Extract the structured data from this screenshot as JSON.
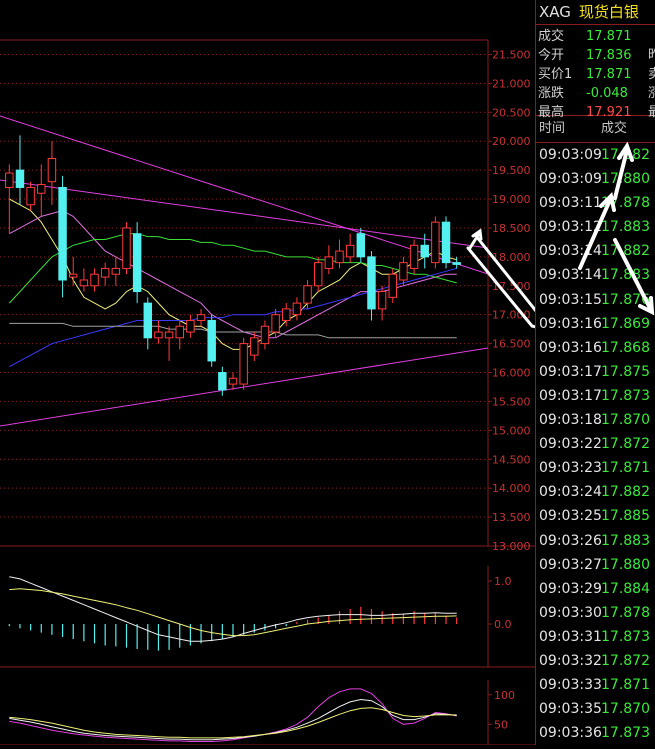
{
  "header": {
    "symbol": "XAG",
    "name": "现货白银"
  },
  "quote": [
    {
      "label": "成交",
      "value": "17.871",
      "trail": "",
      "color": "green"
    },
    {
      "label": "今开",
      "value": "17.836",
      "trail": "昨",
      "color": "green"
    },
    {
      "label": "买价1",
      "value": "17.871",
      "trail": "卖",
      "color": "green"
    },
    {
      "label": "涨跌",
      "value": "-0.048",
      "trail": "涨",
      "color": "green"
    },
    {
      "label": "最高",
      "value": "17.921",
      "trail": "最",
      "color": "red"
    }
  ],
  "ticks_header": {
    "time": "时间",
    "price": "成交"
  },
  "ticks": [
    {
      "time": "09:03:09",
      "price": "17.882"
    },
    {
      "time": "09:03:09",
      "price": "17.880"
    },
    {
      "time": "09:03:11",
      "price": "17.878"
    },
    {
      "time": "09:03:12",
      "price": "17.883"
    },
    {
      "time": "09:03:14",
      "price": "17.882"
    },
    {
      "time": "09:03:14",
      "price": "17.883"
    },
    {
      "time": "09:03:15",
      "price": "17.876"
    },
    {
      "time": "09:03:16",
      "price": "17.869"
    },
    {
      "time": "09:03:16",
      "price": "17.868"
    },
    {
      "time": "09:03:17",
      "price": "17.875"
    },
    {
      "time": "09:03:17",
      "price": "17.873"
    },
    {
      "time": "09:03:18",
      "price": "17.870"
    },
    {
      "time": "09:03:22",
      "price": "17.872"
    },
    {
      "time": "09:03:23",
      "price": "17.871"
    },
    {
      "time": "09:03:24",
      "price": "17.882"
    },
    {
      "time": "09:03:25",
      "price": "17.885"
    },
    {
      "time": "09:03:26",
      "price": "17.883"
    },
    {
      "time": "09:03:27",
      "price": "17.880"
    },
    {
      "time": "09:03:29",
      "price": "17.884"
    },
    {
      "time": "09:03:30",
      "price": "17.878"
    },
    {
      "time": "09:03:31",
      "price": "17.873"
    },
    {
      "time": "09:03:32",
      "price": "17.872"
    },
    {
      "time": "09:03:33",
      "price": "17.871"
    },
    {
      "time": "09:03:35",
      "price": "17.870"
    },
    {
      "time": "09:03:36",
      "price": "17.873"
    }
  ],
  "colors": {
    "up": "#ff3b3b",
    "down": "#54f0f0",
    "grid": "#8a1c1c",
    "axis_text": "#c83232"
  },
  "chart_data": [
    {
      "type": "candlestick",
      "title": "",
      "ylim": [
        13.0,
        21.75
      ],
      "y_ticks": [
        "21.500",
        "21.000",
        "20.500",
        "20.000",
        "19.500",
        "19.000",
        "18.500",
        "18.000",
        "17.500",
        "17.000",
        "16.500",
        "16.000",
        "15.500",
        "15.000",
        "14.500",
        "14.000",
        "13.500",
        "13.000"
      ],
      "candles": [
        {
          "o": 19.2,
          "h": 19.6,
          "l": 18.4,
          "c": 19.45
        },
        {
          "o": 19.5,
          "h": 20.1,
          "l": 18.9,
          "c": 19.2
        },
        {
          "o": 18.9,
          "h": 19.3,
          "l": 18.8,
          "c": 19.2
        },
        {
          "o": 19.1,
          "h": 19.6,
          "l": 18.7,
          "c": 19.25
        },
        {
          "o": 19.3,
          "h": 20.0,
          "l": 18.9,
          "c": 19.7
        },
        {
          "o": 19.2,
          "h": 19.4,
          "l": 17.3,
          "c": 17.6
        },
        {
          "o": 17.65,
          "h": 18.0,
          "l": 17.5,
          "c": 17.7
        },
        {
          "o": 17.5,
          "h": 17.8,
          "l": 17.4,
          "c": 17.6
        },
        {
          "o": 17.5,
          "h": 17.8,
          "l": 17.4,
          "c": 17.7
        },
        {
          "o": 17.65,
          "h": 17.9,
          "l": 17.5,
          "c": 17.8
        },
        {
          "o": 17.7,
          "h": 18.0,
          "l": 17.5,
          "c": 17.8
        },
        {
          "o": 17.8,
          "h": 18.6,
          "l": 17.7,
          "c": 18.5
        },
        {
          "o": 18.4,
          "h": 18.6,
          "l": 17.2,
          "c": 17.4
        },
        {
          "o": 17.2,
          "h": 17.3,
          "l": 16.4,
          "c": 16.6
        },
        {
          "o": 16.6,
          "h": 16.9,
          "l": 16.5,
          "c": 16.7
        },
        {
          "o": 16.6,
          "h": 16.8,
          "l": 16.2,
          "c": 16.7
        },
        {
          "o": 16.6,
          "h": 16.9,
          "l": 16.4,
          "c": 16.8
        },
        {
          "o": 16.7,
          "h": 17.0,
          "l": 16.6,
          "c": 16.9
        },
        {
          "o": 16.9,
          "h": 17.1,
          "l": 16.8,
          "c": 17.0
        },
        {
          "o": 16.9,
          "h": 17.0,
          "l": 16.1,
          "c": 16.2
        },
        {
          "o": 16.0,
          "h": 16.1,
          "l": 15.6,
          "c": 15.7
        },
        {
          "o": 15.8,
          "h": 16.0,
          "l": 15.7,
          "c": 15.9
        },
        {
          "o": 15.8,
          "h": 16.6,
          "l": 15.7,
          "c": 16.5
        },
        {
          "o": 16.3,
          "h": 16.7,
          "l": 16.2,
          "c": 16.6
        },
        {
          "o": 16.5,
          "h": 16.9,
          "l": 16.4,
          "c": 16.8
        },
        {
          "o": 16.7,
          "h": 17.1,
          "l": 16.6,
          "c": 17.0
        },
        {
          "o": 16.9,
          "h": 17.2,
          "l": 16.8,
          "c": 17.1
        },
        {
          "o": 17.0,
          "h": 17.3,
          "l": 16.9,
          "c": 17.2
        },
        {
          "o": 17.2,
          "h": 17.6,
          "l": 17.1,
          "c": 17.5
        },
        {
          "o": 17.5,
          "h": 18.0,
          "l": 17.4,
          "c": 17.9
        },
        {
          "o": 17.8,
          "h": 18.2,
          "l": 17.7,
          "c": 18.0
        },
        {
          "o": 17.9,
          "h": 18.3,
          "l": 17.8,
          "c": 18.1
        },
        {
          "o": 18.0,
          "h": 18.4,
          "l": 17.9,
          "c": 18.2
        },
        {
          "o": 18.4,
          "h": 18.5,
          "l": 17.9,
          "c": 18.0
        },
        {
          "o": 18.0,
          "h": 18.1,
          "l": 16.9,
          "c": 17.1
        },
        {
          "o": 17.1,
          "h": 17.5,
          "l": 16.9,
          "c": 17.4
        },
        {
          "o": 17.3,
          "h": 17.8,
          "l": 17.2,
          "c": 17.7
        },
        {
          "o": 17.6,
          "h": 18.0,
          "l": 17.5,
          "c": 17.9
        },
        {
          "o": 17.8,
          "h": 18.3,
          "l": 17.7,
          "c": 18.2
        },
        {
          "o": 18.2,
          "h": 18.4,
          "l": 17.8,
          "c": 18.0
        },
        {
          "o": 17.9,
          "h": 18.7,
          "l": 17.8,
          "c": 18.6
        },
        {
          "o": 18.6,
          "h": 18.7,
          "l": 17.8,
          "c": 17.9
        },
        {
          "o": 17.9,
          "h": 18.0,
          "l": 17.8,
          "c": 17.87
        }
      ],
      "series": [
        {
          "color": "#f0f078",
          "values": [
            19.0,
            18.9,
            18.8,
            18.6,
            18.3,
            18.0,
            17.6,
            17.3,
            17.2,
            17.1,
            17.2,
            17.4,
            17.5,
            17.4,
            17.2,
            17.0,
            16.9,
            16.8,
            16.8,
            16.7,
            16.5,
            16.4,
            16.4,
            16.5,
            16.6,
            16.7,
            16.9,
            17.0,
            17.2,
            17.4,
            17.5,
            17.6,
            17.8,
            17.9,
            17.8,
            17.7,
            17.7,
            17.8,
            17.9,
            18.0,
            18.1,
            18.0,
            17.95
          ]
        },
        {
          "color": "#e070e0",
          "values": [
            18.4,
            18.5,
            18.6,
            18.7,
            18.75,
            18.8,
            18.7,
            18.5,
            18.3,
            18.1,
            18.0,
            17.9,
            17.8,
            17.7,
            17.6,
            17.5,
            17.4,
            17.3,
            17.2,
            17.0,
            16.9,
            16.8,
            16.7,
            16.65,
            16.6,
            16.6,
            16.7,
            16.8,
            16.9,
            17.0,
            17.1,
            17.2,
            17.3,
            17.4,
            17.4,
            17.4,
            17.45,
            17.5,
            17.55,
            17.6,
            17.65,
            17.7,
            17.7
          ]
        },
        {
          "color": "#38e038",
          "values": [
            17.2,
            17.4,
            17.6,
            17.8,
            18.0,
            18.1,
            18.2,
            18.25,
            18.3,
            18.3,
            18.35,
            18.4,
            18.4,
            18.35,
            18.35,
            18.3,
            18.3,
            18.3,
            18.25,
            18.25,
            18.2,
            18.2,
            18.15,
            18.1,
            18.1,
            18.05,
            18.0,
            18.0,
            18.0,
            17.95,
            17.95,
            17.9,
            17.9,
            17.9,
            17.85,
            17.85,
            17.8,
            17.75,
            17.7,
            17.7,
            17.65,
            17.6,
            17.55
          ]
        },
        {
          "color": "#3a3aff",
          "values": [
            16.1,
            16.2,
            16.3,
            16.4,
            16.5,
            16.55,
            16.6,
            16.65,
            16.7,
            16.75,
            16.8,
            16.85,
            16.9,
            16.9,
            16.9,
            16.9,
            16.9,
            16.9,
            16.95,
            16.95,
            16.95,
            17.0,
            17.0,
            17.0,
            17.0,
            17.05,
            17.05,
            17.1,
            17.1,
            17.15,
            17.2,
            17.25,
            17.3,
            17.35,
            17.4,
            17.45,
            17.5,
            17.55,
            17.6,
            17.65,
            17.7,
            17.75,
            17.8
          ]
        },
        {
          "color": "#a0a0a0",
          "values": [
            16.85,
            16.85,
            16.85,
            16.85,
            16.85,
            16.85,
            16.8,
            16.8,
            16.8,
            16.8,
            16.8,
            16.8,
            16.8,
            16.8,
            16.8,
            16.75,
            16.75,
            16.75,
            16.75,
            16.7,
            16.7,
            16.7,
            16.7,
            16.7,
            16.7,
            16.7,
            16.65,
            16.65,
            16.65,
            16.65,
            16.6,
            16.6,
            16.6,
            16.6,
            16.6,
            16.6,
            16.6,
            16.6,
            16.6,
            16.6,
            16.6,
            16.6,
            16.6
          ]
        }
      ]
    },
    {
      "type": "bar",
      "title": "",
      "ylim": [
        -1.0,
        1.35
      ],
      "y_ticks": [
        "1.0",
        "0.0"
      ],
      "values": [
        -0.05,
        -0.1,
        -0.15,
        -0.2,
        -0.25,
        -0.3,
        -0.35,
        -0.4,
        -0.45,
        -0.5,
        -0.52,
        -0.55,
        -0.58,
        -0.6,
        -0.62,
        -0.6,
        -0.55,
        -0.5,
        -0.45,
        -0.4,
        -0.35,
        -0.3,
        -0.25,
        -0.2,
        -0.15,
        -0.1,
        -0.05,
        0.05,
        0.1,
        0.15,
        0.2,
        0.3,
        0.35,
        0.4,
        0.35,
        0.3,
        0.25,
        0.25,
        0.3,
        0.25,
        0.25,
        0.2,
        0.15
      ],
      "series": [
        {
          "color": "#f0f0f0",
          "values": [
            1.1,
            1.05,
            0.95,
            0.85,
            0.75,
            0.65,
            0.55,
            0.45,
            0.35,
            0.25,
            0.15,
            0.05,
            -0.05,
            -0.15,
            -0.25,
            -0.3,
            -0.35,
            -0.4,
            -0.4,
            -0.38,
            -0.35,
            -0.3,
            -0.22,
            -0.15,
            -0.08,
            -0.02,
            0.03,
            0.1,
            0.15,
            0.18,
            0.2,
            0.22,
            0.22,
            0.22,
            0.2,
            0.2,
            0.22,
            0.23,
            0.25,
            0.25,
            0.26,
            0.25,
            0.25
          ]
        },
        {
          "color": "#f0f078",
          "values": [
            0.8,
            0.82,
            0.8,
            0.78,
            0.74,
            0.7,
            0.65,
            0.6,
            0.55,
            0.5,
            0.45,
            0.38,
            0.32,
            0.24,
            0.16,
            0.08,
            0.0,
            -0.08,
            -0.15,
            -0.2,
            -0.24,
            -0.27,
            -0.27,
            -0.25,
            -0.2,
            -0.15,
            -0.1,
            -0.05,
            0.0,
            0.03,
            0.06,
            0.08,
            0.1,
            0.11,
            0.12,
            0.13,
            0.14,
            0.15,
            0.16,
            0.17,
            0.18,
            0.18,
            0.19
          ]
        }
      ]
    },
    {
      "type": "line",
      "title": "",
      "ylim": [
        15,
        125
      ],
      "y_ticks": [
        "100",
        "50"
      ],
      "series": [
        {
          "color": "#e040e0",
          "values": [
            55,
            52,
            48,
            44,
            40,
            37,
            34,
            32,
            30,
            28,
            27,
            26,
            25,
            24,
            23,
            22,
            22,
            21,
            21,
            21,
            22,
            24,
            27,
            30,
            33,
            37,
            42,
            50,
            62,
            80,
            95,
            105,
            110,
            110,
            102,
            85,
            60,
            50,
            52,
            60,
            70,
            68,
            64
          ]
        },
        {
          "color": "#f0f0f0",
          "values": [
            60,
            57,
            54,
            50,
            46,
            42,
            38,
            35,
            33,
            31,
            30,
            29,
            28,
            27,
            26,
            25,
            25,
            24,
            24,
            24,
            25,
            26,
            28,
            30,
            33,
            36,
            40,
            45,
            52,
            60,
            70,
            80,
            88,
            92,
            90,
            80,
            65,
            58,
            58,
            62,
            68,
            67,
            65
          ]
        },
        {
          "color": "#f0f078",
          "values": [
            62,
            60,
            58,
            55,
            52,
            48,
            44,
            40,
            37,
            35,
            33,
            32,
            31,
            30,
            29,
            28,
            28,
            27,
            27,
            27,
            27,
            28,
            29,
            31,
            33,
            35,
            38,
            42,
            47,
            53,
            60,
            67,
            73,
            77,
            78,
            75,
            70,
            65,
            63,
            64,
            66,
            66,
            66
          ]
        }
      ]
    }
  ]
}
